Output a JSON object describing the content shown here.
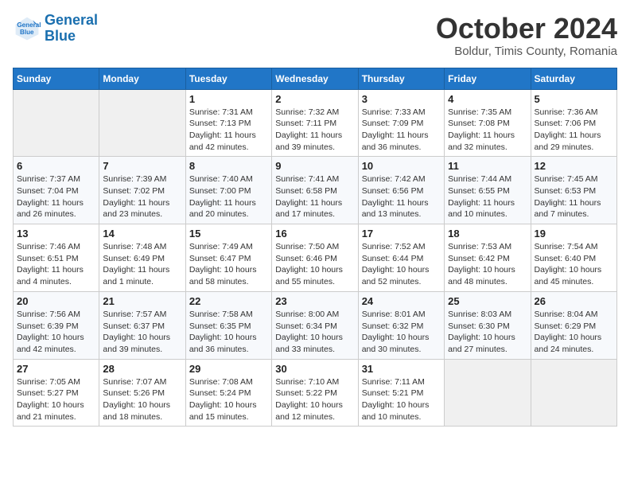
{
  "header": {
    "logo_line1": "General",
    "logo_line2": "Blue",
    "title": "October 2024",
    "subtitle": "Boldur, Timis County, Romania"
  },
  "weekdays": [
    "Sunday",
    "Monday",
    "Tuesday",
    "Wednesday",
    "Thursday",
    "Friday",
    "Saturday"
  ],
  "weeks": [
    [
      {
        "day": "",
        "info": ""
      },
      {
        "day": "",
        "info": ""
      },
      {
        "day": "1",
        "info": "Sunrise: 7:31 AM\nSunset: 7:13 PM\nDaylight: 11 hours and 42 minutes."
      },
      {
        "day": "2",
        "info": "Sunrise: 7:32 AM\nSunset: 7:11 PM\nDaylight: 11 hours and 39 minutes."
      },
      {
        "day": "3",
        "info": "Sunrise: 7:33 AM\nSunset: 7:09 PM\nDaylight: 11 hours and 36 minutes."
      },
      {
        "day": "4",
        "info": "Sunrise: 7:35 AM\nSunset: 7:08 PM\nDaylight: 11 hours and 32 minutes."
      },
      {
        "day": "5",
        "info": "Sunrise: 7:36 AM\nSunset: 7:06 PM\nDaylight: 11 hours and 29 minutes."
      }
    ],
    [
      {
        "day": "6",
        "info": "Sunrise: 7:37 AM\nSunset: 7:04 PM\nDaylight: 11 hours and 26 minutes."
      },
      {
        "day": "7",
        "info": "Sunrise: 7:39 AM\nSunset: 7:02 PM\nDaylight: 11 hours and 23 minutes."
      },
      {
        "day": "8",
        "info": "Sunrise: 7:40 AM\nSunset: 7:00 PM\nDaylight: 11 hours and 20 minutes."
      },
      {
        "day": "9",
        "info": "Sunrise: 7:41 AM\nSunset: 6:58 PM\nDaylight: 11 hours and 17 minutes."
      },
      {
        "day": "10",
        "info": "Sunrise: 7:42 AM\nSunset: 6:56 PM\nDaylight: 11 hours and 13 minutes."
      },
      {
        "day": "11",
        "info": "Sunrise: 7:44 AM\nSunset: 6:55 PM\nDaylight: 11 hours and 10 minutes."
      },
      {
        "day": "12",
        "info": "Sunrise: 7:45 AM\nSunset: 6:53 PM\nDaylight: 11 hours and 7 minutes."
      }
    ],
    [
      {
        "day": "13",
        "info": "Sunrise: 7:46 AM\nSunset: 6:51 PM\nDaylight: 11 hours and 4 minutes."
      },
      {
        "day": "14",
        "info": "Sunrise: 7:48 AM\nSunset: 6:49 PM\nDaylight: 11 hours and 1 minute."
      },
      {
        "day": "15",
        "info": "Sunrise: 7:49 AM\nSunset: 6:47 PM\nDaylight: 10 hours and 58 minutes."
      },
      {
        "day": "16",
        "info": "Sunrise: 7:50 AM\nSunset: 6:46 PM\nDaylight: 10 hours and 55 minutes."
      },
      {
        "day": "17",
        "info": "Sunrise: 7:52 AM\nSunset: 6:44 PM\nDaylight: 10 hours and 52 minutes."
      },
      {
        "day": "18",
        "info": "Sunrise: 7:53 AM\nSunset: 6:42 PM\nDaylight: 10 hours and 48 minutes."
      },
      {
        "day": "19",
        "info": "Sunrise: 7:54 AM\nSunset: 6:40 PM\nDaylight: 10 hours and 45 minutes."
      }
    ],
    [
      {
        "day": "20",
        "info": "Sunrise: 7:56 AM\nSunset: 6:39 PM\nDaylight: 10 hours and 42 minutes."
      },
      {
        "day": "21",
        "info": "Sunrise: 7:57 AM\nSunset: 6:37 PM\nDaylight: 10 hours and 39 minutes."
      },
      {
        "day": "22",
        "info": "Sunrise: 7:58 AM\nSunset: 6:35 PM\nDaylight: 10 hours and 36 minutes."
      },
      {
        "day": "23",
        "info": "Sunrise: 8:00 AM\nSunset: 6:34 PM\nDaylight: 10 hours and 33 minutes."
      },
      {
        "day": "24",
        "info": "Sunrise: 8:01 AM\nSunset: 6:32 PM\nDaylight: 10 hours and 30 minutes."
      },
      {
        "day": "25",
        "info": "Sunrise: 8:03 AM\nSunset: 6:30 PM\nDaylight: 10 hours and 27 minutes."
      },
      {
        "day": "26",
        "info": "Sunrise: 8:04 AM\nSunset: 6:29 PM\nDaylight: 10 hours and 24 minutes."
      }
    ],
    [
      {
        "day": "27",
        "info": "Sunrise: 7:05 AM\nSunset: 5:27 PM\nDaylight: 10 hours and 21 minutes."
      },
      {
        "day": "28",
        "info": "Sunrise: 7:07 AM\nSunset: 5:26 PM\nDaylight: 10 hours and 18 minutes."
      },
      {
        "day": "29",
        "info": "Sunrise: 7:08 AM\nSunset: 5:24 PM\nDaylight: 10 hours and 15 minutes."
      },
      {
        "day": "30",
        "info": "Sunrise: 7:10 AM\nSunset: 5:22 PM\nDaylight: 10 hours and 12 minutes."
      },
      {
        "day": "31",
        "info": "Sunrise: 7:11 AM\nSunset: 5:21 PM\nDaylight: 10 hours and 10 minutes."
      },
      {
        "day": "",
        "info": ""
      },
      {
        "day": "",
        "info": ""
      }
    ]
  ]
}
